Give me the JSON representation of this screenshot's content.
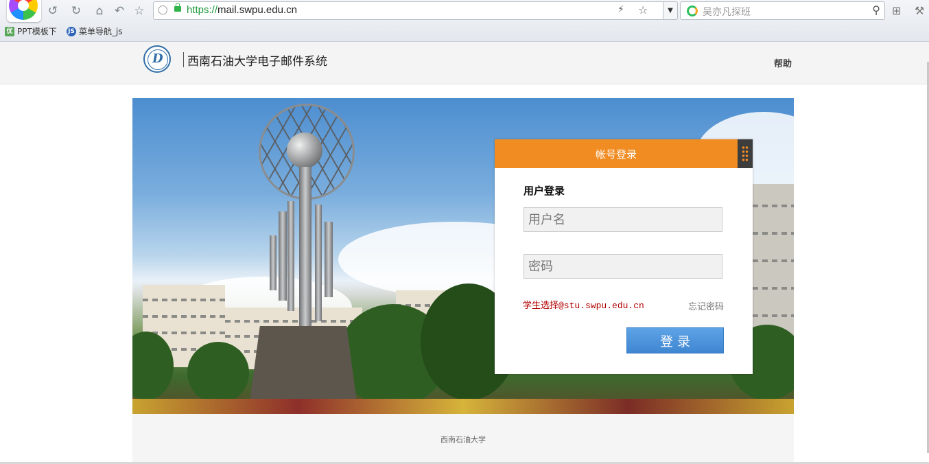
{
  "browser": {
    "url_scheme": "https://",
    "url_host": "mail.swpu.edu.cn",
    "search_placeholder": "吴亦凡探班",
    "bookmarks": [
      {
        "label": "PPT模板下",
        "icon_text": "优"
      },
      {
        "label": "菜单导航_js",
        "icon_text": "JS"
      }
    ]
  },
  "header": {
    "site_title": "西南石油大学电子邮件系统",
    "help_label": "帮助"
  },
  "login": {
    "panel_title": "帐号登录",
    "heading": "用户登录",
    "username_placeholder": "用户名",
    "password_placeholder": "密码",
    "student_hint": "学生选择@stu.swpu.edu.cn",
    "forgot_label": "忘记密码",
    "submit_label": "登录"
  },
  "footer": {
    "text": "西南石油大学"
  },
  "colors": {
    "panel_header": "#f08c22",
    "button": "#4a90d9",
    "hint_red": "#b30000"
  }
}
